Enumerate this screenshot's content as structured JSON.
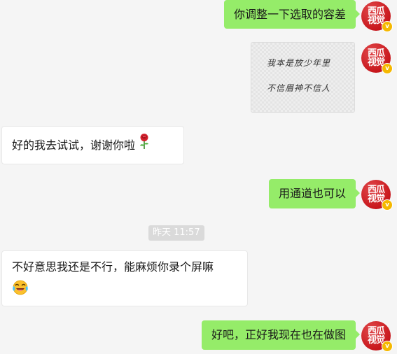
{
  "messages": [
    {
      "direction": "out",
      "text": "你调整一下选取的容差"
    },
    {
      "direction": "out",
      "type": "image",
      "image_lines": [
        "我本是放少年里",
        "不信眉神不信人"
      ]
    },
    {
      "direction": "in",
      "text": "好的我去试试，谢谢你啦",
      "emoji": "rose"
    },
    {
      "direction": "out",
      "text": "用通道也可以"
    },
    {
      "direction": "in",
      "text": "不好意思我还是不行，能麻烦你录个屏嘛",
      "emoji": "tears-of-joy"
    },
    {
      "direction": "out",
      "text": "好吧，正好我现在也在做图"
    }
  ],
  "timestamp": "昨天 11:57",
  "avatar": {
    "line1": "西瓜",
    "line2": "视觉",
    "badge": "v",
    "color": "#c8171c",
    "badge_color": "#f5b800"
  },
  "colors": {
    "background": "#f5f5f5",
    "outgoing_bubble": "#95ec69",
    "incoming_bubble": "#ffffff"
  }
}
